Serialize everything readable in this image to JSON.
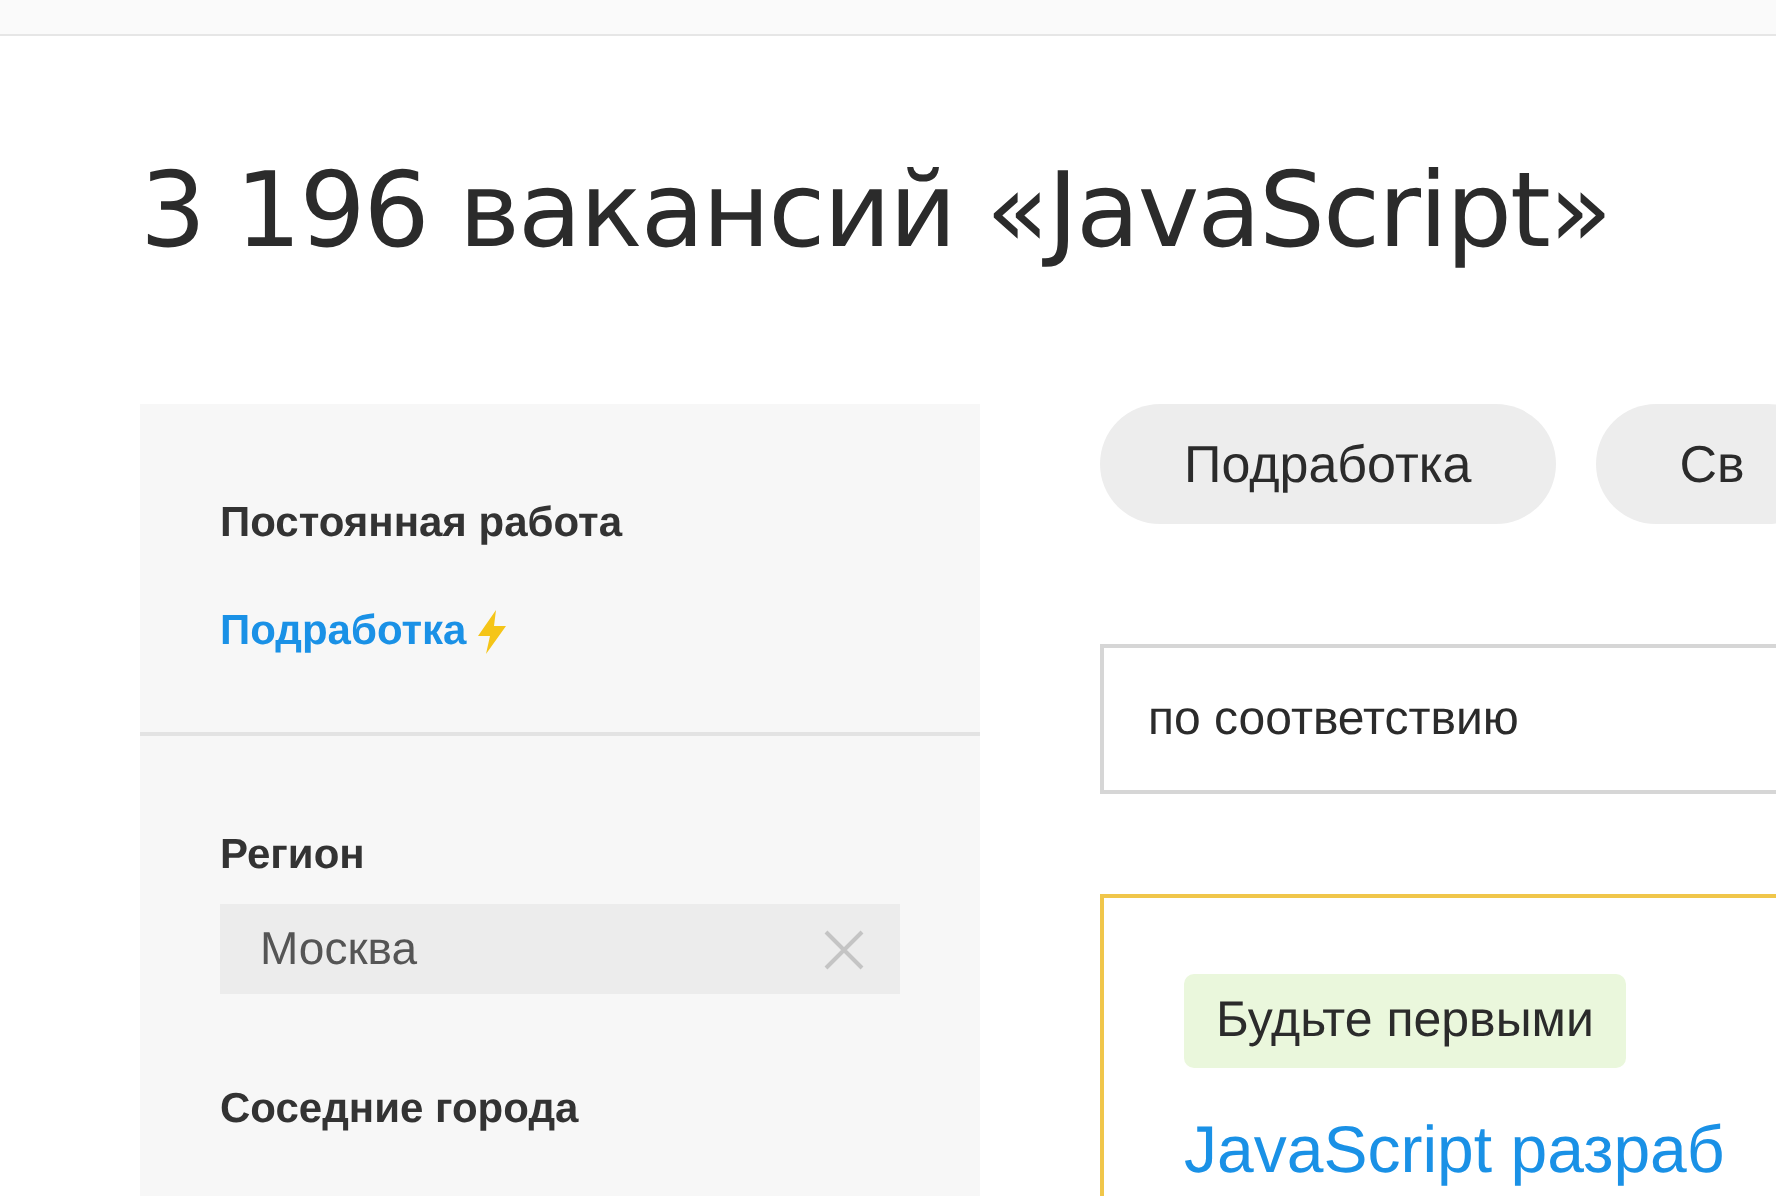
{
  "title": "3 196 вакансий «JavaScript»",
  "sidebar": {
    "employment": [
      {
        "label": "Постоянная работа",
        "selected": true,
        "flash": false
      },
      {
        "label": "Подработка",
        "selected": false,
        "flash": true
      }
    ],
    "region": {
      "label": "Регион",
      "value": "Москва"
    },
    "nearby": {
      "label": "Соседние города"
    }
  },
  "chips": [
    {
      "label": "Подработка"
    },
    {
      "label": "Св"
    }
  ],
  "sort": {
    "value": "по соответствию"
  },
  "vacancy": {
    "badge": "Будьте первыми",
    "title": "JavaScript разраб"
  }
}
